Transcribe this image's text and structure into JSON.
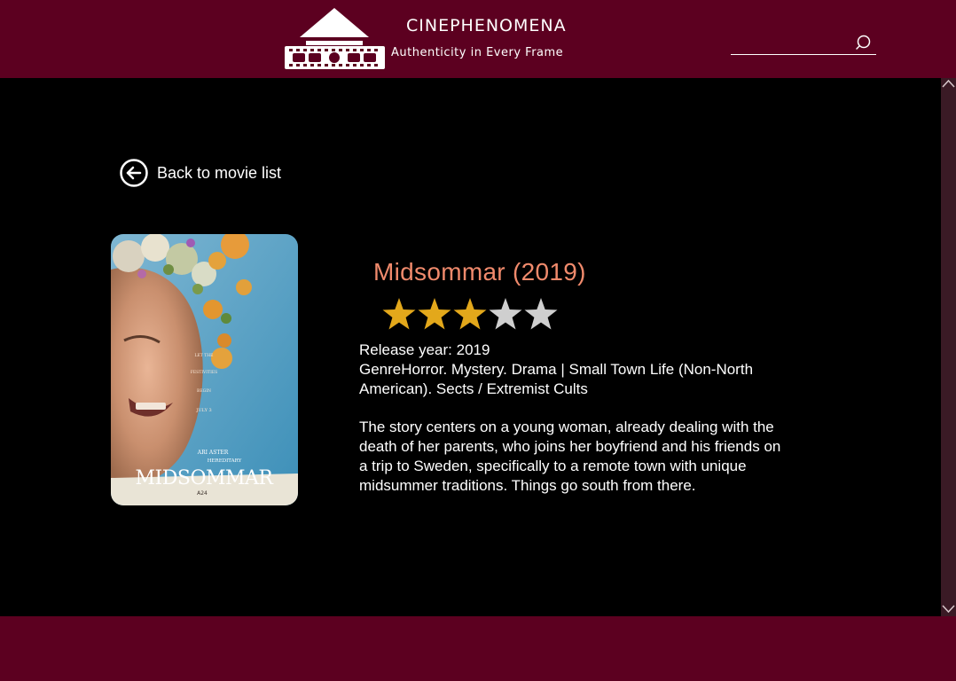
{
  "header": {
    "brand_name": "CINEPHENOMENA",
    "tagline": "Authenticity in Every Frame",
    "search": {
      "value": "",
      "placeholder": ""
    },
    "logo_icon": "cinema-building-logo",
    "search_icon": "magnifier-icon"
  },
  "main": {
    "back_link": {
      "label": "Back to movie list",
      "icon": "arrow-left-circle-icon"
    },
    "movie": {
      "title": "Midsommar (2019)",
      "rating": {
        "value": 3,
        "max": 5,
        "filled_color": "#e3a81b",
        "empty_color": "#cfcfcf"
      },
      "release_year": "Release year: 2019",
      "genre": "GenreHorror. Mystery. Drama | Small Town Life (Non-North American). Sects / Extremist Cults",
      "description": "The story centers on a young woman, already dealing with the death of her parents, who joins her boyfriend and his friends on a trip to Sweden, specifically to a remote town with unique midsummer traditions. Things go south from there.",
      "poster": {
        "title_text": "MIDSOMMAR",
        "tagline_lines": [
          "LET THE",
          "FESTIVITIES",
          "BEGIN",
          "JULY 3"
        ],
        "credit_line1": "ARI ASTER",
        "credit_line2": "HEREDITARY",
        "studio": "A24"
      }
    }
  },
  "colors": {
    "header_bg": "#5c0020",
    "footer_bg": "#5c0020",
    "title": "#f08a6c",
    "scrollbar": "#3a1a25"
  }
}
